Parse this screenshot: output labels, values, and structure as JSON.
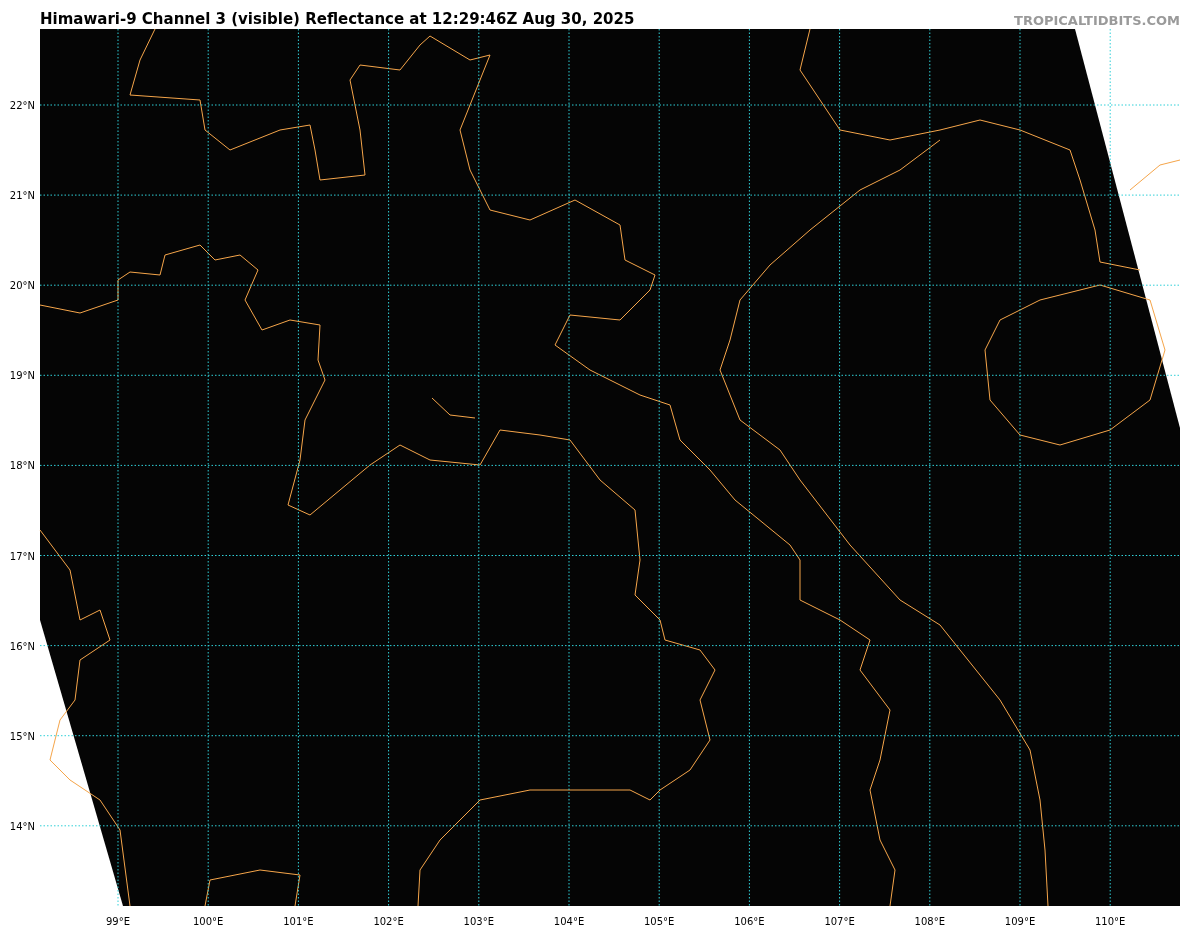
{
  "title": "Himawari-9 Channel 3 (visible) Reflectance at 12:29:46Z Aug 30, 2025",
  "credit": "TROPICALTIDBITS.COM",
  "map": {
    "x_ticks": [
      "99°E",
      "100°E",
      "101°E",
      "102°E",
      "103°E",
      "104°E",
      "105°E",
      "106°E",
      "107°E",
      "108°E",
      "109°E",
      "110°E"
    ],
    "y_ticks": [
      "22°N",
      "21°N",
      "20°N",
      "19°N",
      "18°N",
      "17°N",
      "16°N",
      "15°N",
      "14°N"
    ]
  }
}
